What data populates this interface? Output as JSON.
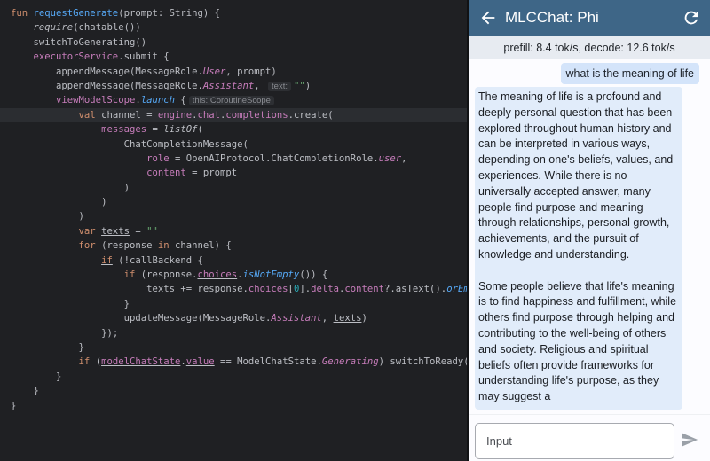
{
  "editor": {
    "lines": [
      {
        "indent": 0,
        "hl": false,
        "toks": [
          [
            "kw",
            "fun "
          ],
          [
            "fn",
            "requestGenerate"
          ],
          [
            "",
            "(prompt: String) {"
          ]
        ]
      },
      {
        "indent": 1,
        "hl": false,
        "toks": [
          [
            "it",
            "require"
          ],
          [
            "",
            "(chatable())"
          ]
        ]
      },
      {
        "indent": 1,
        "hl": false,
        "toks": [
          [
            "",
            "switchToGenerating()"
          ]
        ]
      },
      {
        "indent": 1,
        "hl": false,
        "toks": [
          [
            "pr",
            "executorService"
          ],
          [
            "",
            ".submit {"
          ]
        ]
      },
      {
        "indent": 2,
        "hl": false,
        "toks": [
          [
            "",
            "appendMessage(MessageRole."
          ],
          [
            "en",
            "User"
          ],
          [
            "",
            ", prompt)"
          ]
        ]
      },
      {
        "indent": 2,
        "hl": false,
        "toks": [
          [
            "",
            "appendMessage(MessageRole."
          ],
          [
            "en",
            "Assistant"
          ],
          [
            "",
            ", "
          ],
          [
            "hint",
            "text:"
          ],
          [
            "st",
            "\"\""
          ],
          [
            "",
            ")"
          ]
        ]
      },
      {
        "indent": 2,
        "hl": false,
        "toks": [
          [
            "pr",
            "viewModelScope"
          ],
          [
            "",
            "."
          ],
          [
            "fn it",
            "launch"
          ],
          [
            "",
            " {"
          ],
          [
            "hint",
            "this: CoroutineScope"
          ]
        ]
      },
      {
        "indent": 3,
        "hl": true,
        "toks": [
          [
            "kw",
            "val "
          ],
          [
            "",
            "channel = "
          ],
          [
            "pr",
            "engine"
          ],
          [
            "",
            "."
          ],
          [
            "pr",
            "chat"
          ],
          [
            "",
            "."
          ],
          [
            "pr",
            "completions"
          ],
          [
            "",
            ".create("
          ]
        ]
      },
      {
        "indent": 4,
        "hl": false,
        "toks": [
          [
            "pr",
            "messages"
          ],
          [
            "",
            " = "
          ],
          [
            "it",
            "listOf"
          ],
          [
            "",
            "("
          ]
        ]
      },
      {
        "indent": 5,
        "hl": false,
        "toks": [
          [
            "",
            "ChatCompletionMessage("
          ]
        ]
      },
      {
        "indent": 6,
        "hl": false,
        "toks": [
          [
            "pr",
            "role"
          ],
          [
            "",
            " = OpenAIProtocol.ChatCompletionRole."
          ],
          [
            "en",
            "user"
          ],
          [
            "",
            ","
          ]
        ]
      },
      {
        "indent": 6,
        "hl": false,
        "toks": [
          [
            "pr",
            "content"
          ],
          [
            "",
            " = prompt"
          ]
        ]
      },
      {
        "indent": 5,
        "hl": false,
        "toks": [
          [
            "",
            ")"
          ]
        ]
      },
      {
        "indent": 4,
        "hl": false,
        "toks": [
          [
            "",
            ")"
          ]
        ]
      },
      {
        "indent": 3,
        "hl": false,
        "toks": [
          [
            "",
            ")"
          ]
        ]
      },
      {
        "indent": 3,
        "hl": false,
        "toks": [
          [
            "kw",
            "var "
          ],
          [
            "ul",
            "texts"
          ],
          [
            "",
            " = "
          ],
          [
            "st",
            "\"\""
          ]
        ]
      },
      {
        "indent": 3,
        "hl": false,
        "toks": [
          [
            "kw",
            "for "
          ],
          [
            "",
            "(response "
          ],
          [
            "kw",
            "in "
          ],
          [
            "",
            "channel) {"
          ]
        ]
      },
      {
        "indent": 4,
        "hl": false,
        "toks": [
          [
            "kw ul",
            "if"
          ],
          [
            "",
            " (!callBackend {"
          ]
        ]
      },
      {
        "indent": 5,
        "hl": false,
        "toks": [
          [
            "kw",
            "if "
          ],
          [
            "",
            "(response."
          ],
          [
            "pr ul",
            "choices"
          ],
          [
            "",
            "."
          ],
          [
            "fn it",
            "isNotEmpty"
          ],
          [
            "",
            "()) {"
          ]
        ]
      },
      {
        "indent": 6,
        "hl": false,
        "toks": [
          [
            "ul",
            "texts"
          ],
          [
            "",
            " += response."
          ],
          [
            "pr ul",
            "choices"
          ],
          [
            "",
            "["
          ],
          [
            "nm",
            "0"
          ],
          [
            "",
            "]."
          ],
          [
            "pr",
            "delta"
          ],
          [
            "",
            "."
          ],
          [
            "pr ul",
            "content"
          ],
          [
            "",
            "?.asText()."
          ],
          [
            "fn it",
            "orEmpty"
          ],
          [
            "",
            "()"
          ]
        ]
      },
      {
        "indent": 5,
        "hl": false,
        "toks": [
          [
            "",
            "}"
          ]
        ]
      },
      {
        "indent": 5,
        "hl": false,
        "toks": [
          [
            "",
            "updateMessage(MessageRole."
          ],
          [
            "en",
            "Assistant"
          ],
          [
            "",
            ", "
          ],
          [
            "ul",
            "texts"
          ],
          [
            "",
            ")"
          ]
        ]
      },
      {
        "indent": 4,
        "hl": false,
        "toks": [
          [
            "",
            "});"
          ]
        ]
      },
      {
        "indent": 3,
        "hl": false,
        "toks": [
          [
            "",
            "}"
          ]
        ]
      },
      {
        "indent": 3,
        "hl": false,
        "toks": [
          [
            "kw",
            "if "
          ],
          [
            "",
            "("
          ],
          [
            "pr ul",
            "modelChatState"
          ],
          [
            "",
            "."
          ],
          [
            "pr ul",
            "value"
          ],
          [
            "",
            " == ModelChatState."
          ],
          [
            "en",
            "Generating"
          ],
          [
            "",
            ") switchToReady()"
          ]
        ]
      },
      {
        "indent": 2,
        "hl": false,
        "toks": [
          [
            "",
            "}"
          ]
        ]
      },
      {
        "indent": 1,
        "hl": false,
        "toks": [
          [
            "",
            "}"
          ]
        ]
      },
      {
        "indent": 0,
        "hl": false,
        "toks": [
          [
            "",
            "}"
          ]
        ]
      }
    ]
  },
  "app": {
    "title": "MLCChat: Phi",
    "back_icon": "arrow-back-icon",
    "refresh_icon": "refresh-icon",
    "stats": "prefill: 8.4 tok/s, decode: 12.6 tok/s",
    "user_message": "what is the meaning of life",
    "bot_message": "The meaning of life is a profound and deeply personal question that has been explored throughout human history and can be interpreted in various ways, depending on one's beliefs, values, and experiences. While there is no universally accepted answer, many people find purpose and meaning through relationships, personal growth, achievements, and the pursuit of knowledge and understanding.\n\nSome people believe that life's meaning is to find happiness and fulfillment, while others find purpose through helping and contributing to the well-being of others and society. Religious and spiritual beliefs often provide frameworks for understanding life's purpose, as they may suggest a",
    "input_placeholder": "Input",
    "send_icon": "send-icon",
    "colors": {
      "appbar": "#3e6687",
      "bot_bubble": "#e1ecfa",
      "user_bubble": "#d4e4fa"
    }
  }
}
